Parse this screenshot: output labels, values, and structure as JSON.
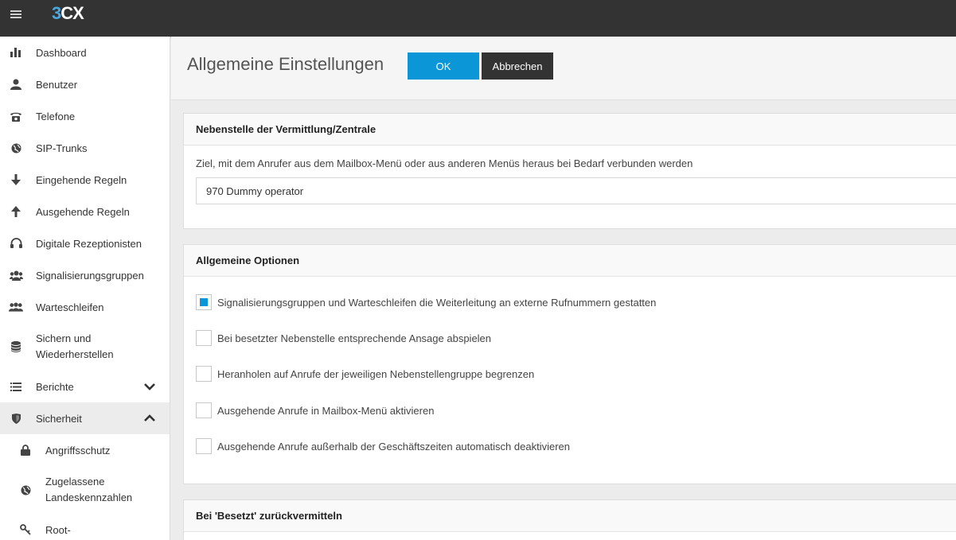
{
  "topbar": {
    "logo_part1": "3",
    "logo_part2": "CX"
  },
  "sidebar": {
    "items": [
      {
        "label": "Dashboard",
        "icon": "bar-chart-icon"
      },
      {
        "label": "Benutzer",
        "icon": "user-icon"
      },
      {
        "label": "Telefone",
        "icon": "phone-icon"
      },
      {
        "label": "SIP-Trunks",
        "icon": "globe-icon"
      },
      {
        "label": "Eingehende Regeln",
        "icon": "arrow-down-icon"
      },
      {
        "label": "Ausgehende Regeln",
        "icon": "arrow-up-icon"
      },
      {
        "label": "Digitale Rezeptionisten",
        "icon": "headset-icon"
      },
      {
        "label": "Signalisierungsgruppen",
        "icon": "group-icon"
      },
      {
        "label": "Warteschleifen",
        "icon": "queue-icon"
      },
      {
        "label": "Sichern und Wiederherstellen",
        "icon": "database-icon"
      },
      {
        "label": "Berichte",
        "icon": "list-icon"
      },
      {
        "label": "Sicherheit",
        "icon": "shield-icon"
      }
    ],
    "sub_items": [
      {
        "label": "Angriffsschutz",
        "icon": "lock-icon"
      },
      {
        "label": "Zugelassene Landeskennzahlen",
        "icon": "globe-icon"
      },
      {
        "label": "Root-",
        "icon": "key-icon"
      }
    ]
  },
  "header": {
    "title": "Allgemeine Einstellungen",
    "ok_label": "OK",
    "cancel_label": "Abbrechen"
  },
  "card1": {
    "title": "Nebenstelle der Vermittlung/Zentrale",
    "field_label": "Ziel, mit dem Anrufer aus dem Mailbox-Menü oder aus anderen Menüs heraus bei Bedarf verbunden werden",
    "field_value": "970 Dummy operator"
  },
  "card2": {
    "title": "Allgemeine Optionen",
    "options": [
      {
        "label": "Signalisierungsgruppen und Warteschleifen die Weiterleitung an externe Rufnummern gestatten",
        "checked": true
      },
      {
        "label": "Bei besetzter Nebenstelle entsprechende Ansage abspielen",
        "checked": false
      },
      {
        "label": "Heranholen auf Anrufe der jeweiligen Nebenstellengruppe begrenzen",
        "checked": false
      },
      {
        "label": "Ausgehende Anrufe in Mailbox-Menü aktivieren",
        "checked": false
      },
      {
        "label": "Ausgehende Anrufe außerhalb der Geschäftszeiten automatisch deaktivieren",
        "checked": false
      }
    ]
  },
  "card3": {
    "title": "Bei 'Besetzt' zurückvermitteln"
  },
  "colors": {
    "accent": "#0b96d8",
    "topbar": "#333333"
  }
}
